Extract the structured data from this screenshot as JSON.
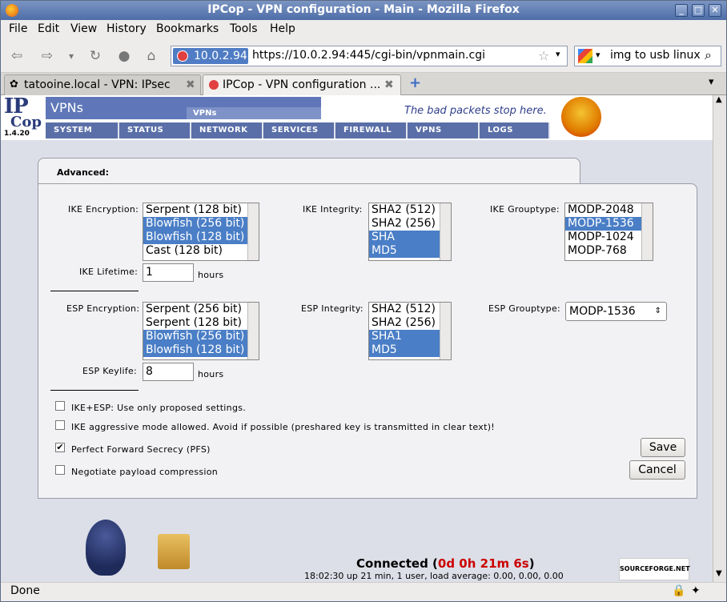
{
  "window": {
    "title": "IPCop - VPN configuration - Main - Mozilla Firefox"
  },
  "menu": [
    "File",
    "Edit",
    "View",
    "History",
    "Bookmarks",
    "Tools",
    "Help"
  ],
  "address": {
    "identity": "10.0.2.94",
    "url": "https://10.0.2.94:445/cgi-bin/vpnmain.cgi"
  },
  "search": {
    "value": "img to usb linux"
  },
  "tabs": [
    {
      "label": "tatooine.local - VPN: IPsec"
    },
    {
      "label": "IPCop - VPN configuration ..."
    }
  ],
  "ipcop": {
    "version": "1.4.20",
    "section": "VPNs",
    "subsection": "VPNs",
    "tagline": "The bad packets stop here.",
    "nav": [
      "SYSTEM",
      "STATUS",
      "NETWORK",
      "SERVICES",
      "FIREWALL",
      "VPNS",
      "LOGS"
    ]
  },
  "panel": {
    "title": "Advanced:",
    "ike_encryption": {
      "label": "IKE Encryption:",
      "options": [
        "Serpent (128 bit)",
        "Blowfish (256 bit)",
        "Blowfish (128 bit)",
        "Cast (128 bit)"
      ],
      "selected": [
        1,
        2
      ]
    },
    "ike_integrity": {
      "label": "IKE Integrity:",
      "options": [
        "SHA2 (512)",
        "SHA2 (256)",
        "SHA",
        "MD5"
      ],
      "selected": [
        2,
        3
      ]
    },
    "ike_grouptype": {
      "label": "IKE Grouptype:",
      "options": [
        "MODP-2048",
        "MODP-1536",
        "MODP-1024",
        "MODP-768"
      ],
      "selected": [
        1
      ]
    },
    "ike_lifetime": {
      "label": "IKE Lifetime:",
      "value": "1",
      "unit": "hours"
    },
    "esp_encryption": {
      "label": "ESP Encryption:",
      "options": [
        "Serpent (256 bit)",
        "Serpent (128 bit)",
        "Blowfish (256 bit)",
        "Blowfish (128 bit)"
      ],
      "selected": [
        2,
        3
      ]
    },
    "esp_integrity": {
      "label": "ESP Integrity:",
      "options": [
        "SHA2 (512)",
        "SHA2 (256)",
        "SHA1",
        "MD5"
      ],
      "selected": [
        2,
        3
      ]
    },
    "esp_grouptype": {
      "label": "ESP Grouptype:",
      "value": "MODP-1536"
    },
    "esp_keylife": {
      "label": "ESP Keylife:",
      "value": "8",
      "unit": "hours"
    },
    "checkboxes": [
      {
        "label": "IKE+ESP: Use only proposed settings.",
        "checked": false
      },
      {
        "label": "IKE aggressive mode allowed. Avoid if possible (preshared key is transmitted in clear text)!",
        "checked": false
      },
      {
        "label": "Perfect Forward Secrecy (PFS)",
        "checked": true
      },
      {
        "label": "Negotiate payload compression",
        "checked": false
      }
    ],
    "save_label": "Save",
    "cancel_label": "Cancel"
  },
  "footer": {
    "connected_label": "Connected (",
    "uptime": "0d 0h 21m 6s",
    "connected_close": ")",
    "load": "18:02:30 up 21 min, 1 user, load average: 0.00, 0.00, 0.00",
    "sourceforge": "SOURCEFORGE.NET"
  },
  "status": {
    "text": "Done"
  },
  "colors": {
    "accent": "#4a7ec6",
    "nav": "#5a6fa8",
    "uptime": "#cc0000"
  }
}
